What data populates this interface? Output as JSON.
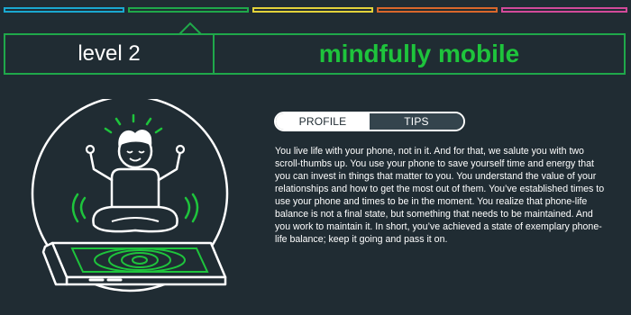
{
  "level_tabs": [
    {
      "color": "#1aa8d0",
      "state": "inactive"
    },
    {
      "color": "#1fa84a",
      "state": "active"
    },
    {
      "color": "#e2d23a",
      "state": "inactive"
    },
    {
      "color": "#d9672b",
      "state": "inactive"
    },
    {
      "color": "#d24a9a",
      "state": "inactive"
    }
  ],
  "header": {
    "level_label": "level 2",
    "level_name": "mindfully mobile"
  },
  "tabs": [
    {
      "label": "PROFILE",
      "active": true
    },
    {
      "label": "TIPS",
      "active": false
    }
  ],
  "description": "You live life with your phone, not in it. And for that, we salute you with two scroll-thumbs up. You use your phone to save yourself time and energy that you can invest in things that matter to you. You understand the value of your relationships and how to get the most out of them. You’ve established times to use your phone and times to be in the moment. You realize that phone-life balance is not a final state, but something that needs to be maintained. And you work to maintain it. In short, you’ve achieved a state of exemplary phone-life balance; keep it going and pass it on.",
  "colors": {
    "background": "#202c33",
    "accent": "#1fa84a",
    "level_name": "#1ec43c",
    "text": "#ffffff"
  },
  "illustration": "meditating-person-on-phone-icon"
}
